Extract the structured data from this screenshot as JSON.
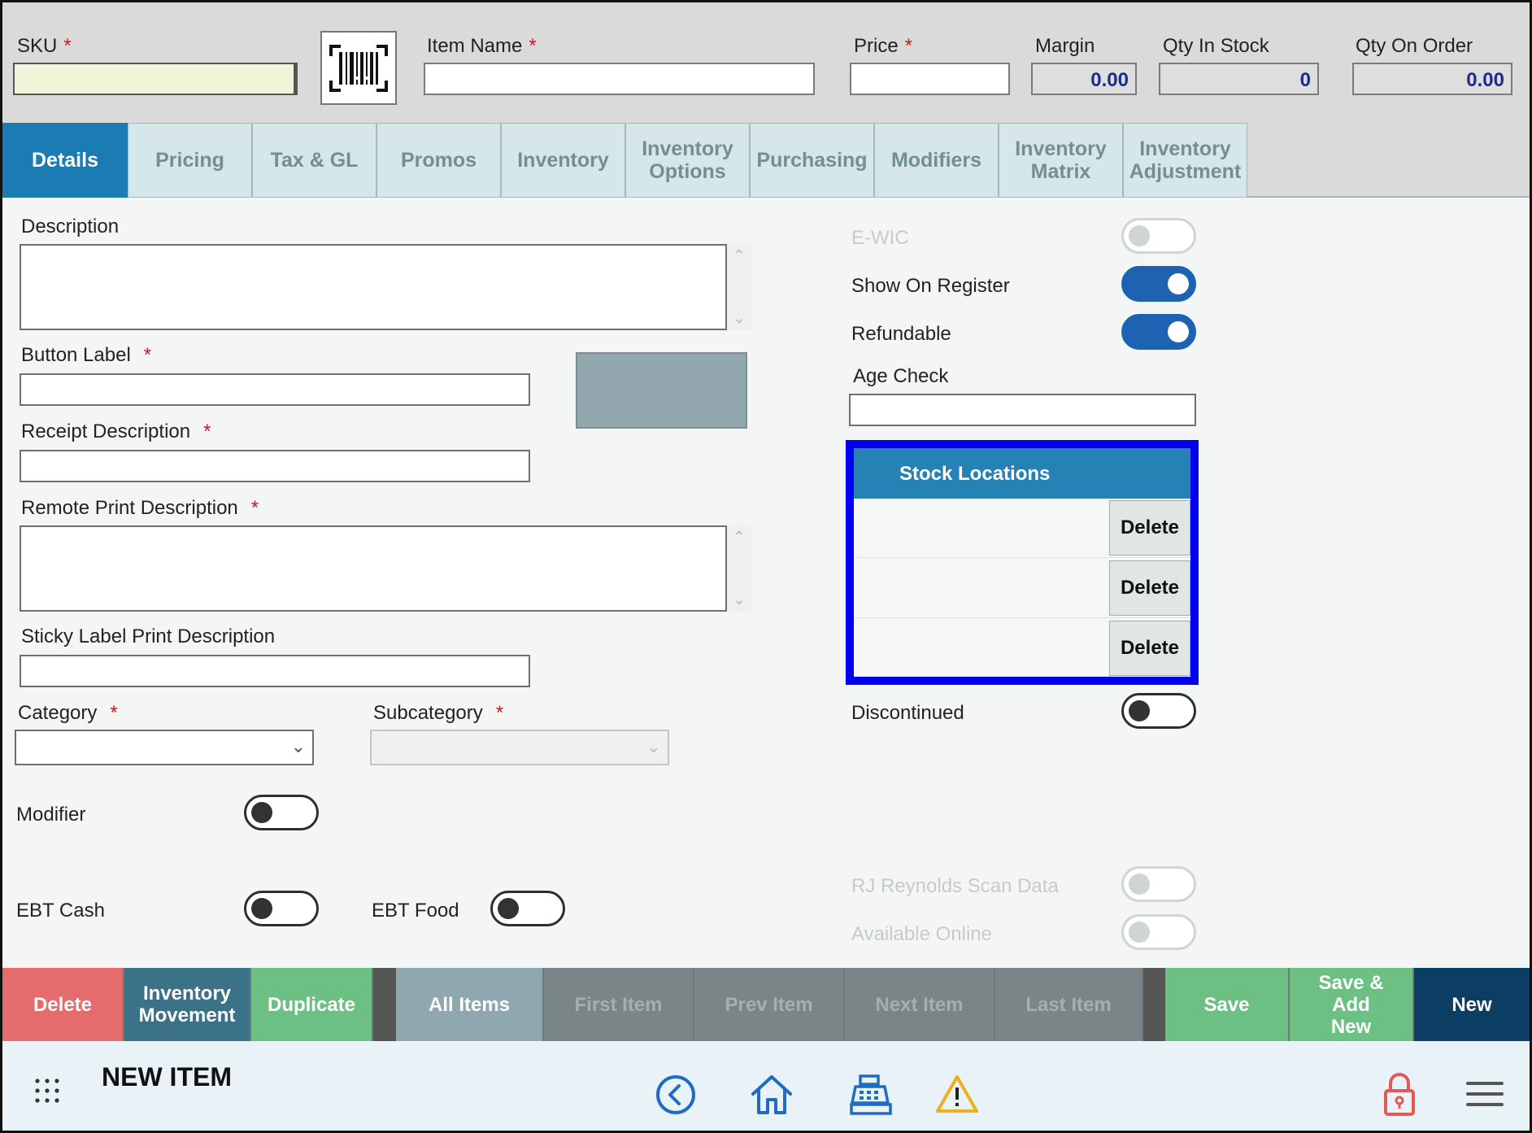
{
  "header": {
    "sku_label": "SKU",
    "sku_value": "",
    "item_name_label": "Item Name",
    "item_name_value": "",
    "price_label": "Price",
    "price_value": "",
    "margin_label": "Margin",
    "margin_value": "0.00",
    "qty_in_stock_label": "Qty In Stock",
    "qty_in_stock_value": "0",
    "qty_on_order_label": "Qty On Order",
    "qty_on_order_value": "0.00",
    "required_mark": "*",
    "barcode_icon": "barcode-scan-icon"
  },
  "tabs": [
    {
      "label": "Details",
      "active": true
    },
    {
      "label": "Pricing"
    },
    {
      "label": "Tax & GL"
    },
    {
      "label": "Promos"
    },
    {
      "label": "Inventory"
    },
    {
      "label": "Inventory Options"
    },
    {
      "label": "Purchasing"
    },
    {
      "label": "Modifiers"
    },
    {
      "label": "Inventory Matrix"
    },
    {
      "label": "Inventory Adjustment"
    }
  ],
  "details": {
    "description_label": "Description",
    "button_label_label": "Button Label",
    "receipt_description_label": "Receipt Description",
    "remote_print_description_label": "Remote Print Description",
    "sticky_label_print_description_label": "Sticky Label Print Description",
    "category_label": "Category",
    "category_value": "",
    "subcategory_label": "Subcategory",
    "subcategory_value": "",
    "modifier_label": "Modifier",
    "ebt_cash_label": "EBT Cash",
    "ebt_food_label": "EBT Food",
    "button_color": "#93a7ae",
    "ewic_label": "E-WIC",
    "show_on_register_label": "Show On Register",
    "refundable_label": "Refundable",
    "age_check_label": "Age Check",
    "age_check_value": "",
    "discontinued_label": "Discontinued",
    "rj_reynolds_label": "RJ Reynolds Scan Data",
    "available_online_label": "Available Online",
    "toggles": {
      "ewic": "off-disabled",
      "show_on_register": "on",
      "refundable": "on",
      "discontinued": "off",
      "modifier": "off",
      "ebt_cash": "off",
      "ebt_food": "off",
      "rj_reynolds": "off-disabled",
      "available_online": "off-disabled"
    }
  },
  "stock_locations": {
    "title": "Stock Locations",
    "rows": [
      {
        "location": "",
        "delete_label": "Delete"
      },
      {
        "location": "",
        "delete_label": "Delete"
      },
      {
        "location": "",
        "delete_label": "Delete"
      }
    ],
    "highlight_color": "#0000f0"
  },
  "actions": [
    {
      "label": "Delete",
      "color": "#e46c6c"
    },
    {
      "label": "Inventory Movement",
      "color": "#3c7288"
    },
    {
      "label": "Duplicate",
      "color": "#6cc084"
    },
    {
      "label": "All Items",
      "color": "#8fa7af"
    },
    {
      "label": "First Item",
      "color": "#7a8587"
    },
    {
      "label": "Prev Item",
      "color": "#7a8587"
    },
    {
      "label": "Next Item",
      "color": "#7a8587"
    },
    {
      "label": "Last Item",
      "color": "#7a8587"
    },
    {
      "label": "Save",
      "color": "#6cc084"
    },
    {
      "label": "Save & Add New",
      "color": "#6cc084"
    },
    {
      "label": "New",
      "color": "#0c3d63"
    }
  ],
  "footer": {
    "page_title": "NEW ITEM",
    "icons": [
      "apps-grid-icon",
      "back-circle-icon",
      "home-icon",
      "cash-register-icon",
      "warning-icon",
      "lock-icon",
      "hamburger-menu-icon"
    ]
  }
}
